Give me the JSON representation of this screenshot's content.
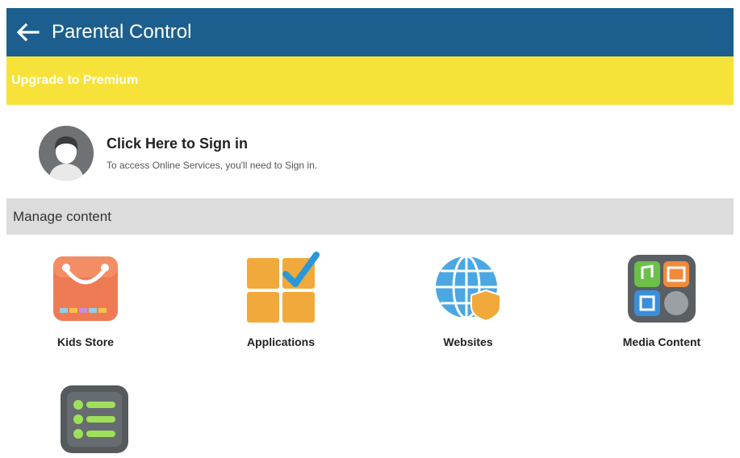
{
  "appbar": {
    "title": "Parental Control",
    "back_icon": "arrow-left-icon"
  },
  "premium_banner": {
    "label": "Upgrade to Premium"
  },
  "signin": {
    "title": "Click Here to Sign in",
    "subtitle": "To access Online Services, you'll need to Sign in.",
    "avatar_icon": "user-avatar-icon"
  },
  "manage_section": {
    "label": "Manage content"
  },
  "tiles": [
    {
      "label": "Kids Store",
      "icon": "shopping-bag-icon"
    },
    {
      "label": "Applications",
      "icon": "app-grid-check-icon"
    },
    {
      "label": "Websites",
      "icon": "globe-shield-icon"
    },
    {
      "label": "Media Content",
      "icon": "media-grid-icon"
    },
    {
      "label": "",
      "icon": "list-icon"
    }
  ],
  "colors": {
    "appbar": "#1c5f8e",
    "premium": "#f7e23a",
    "section": "#dcdcdc"
  }
}
